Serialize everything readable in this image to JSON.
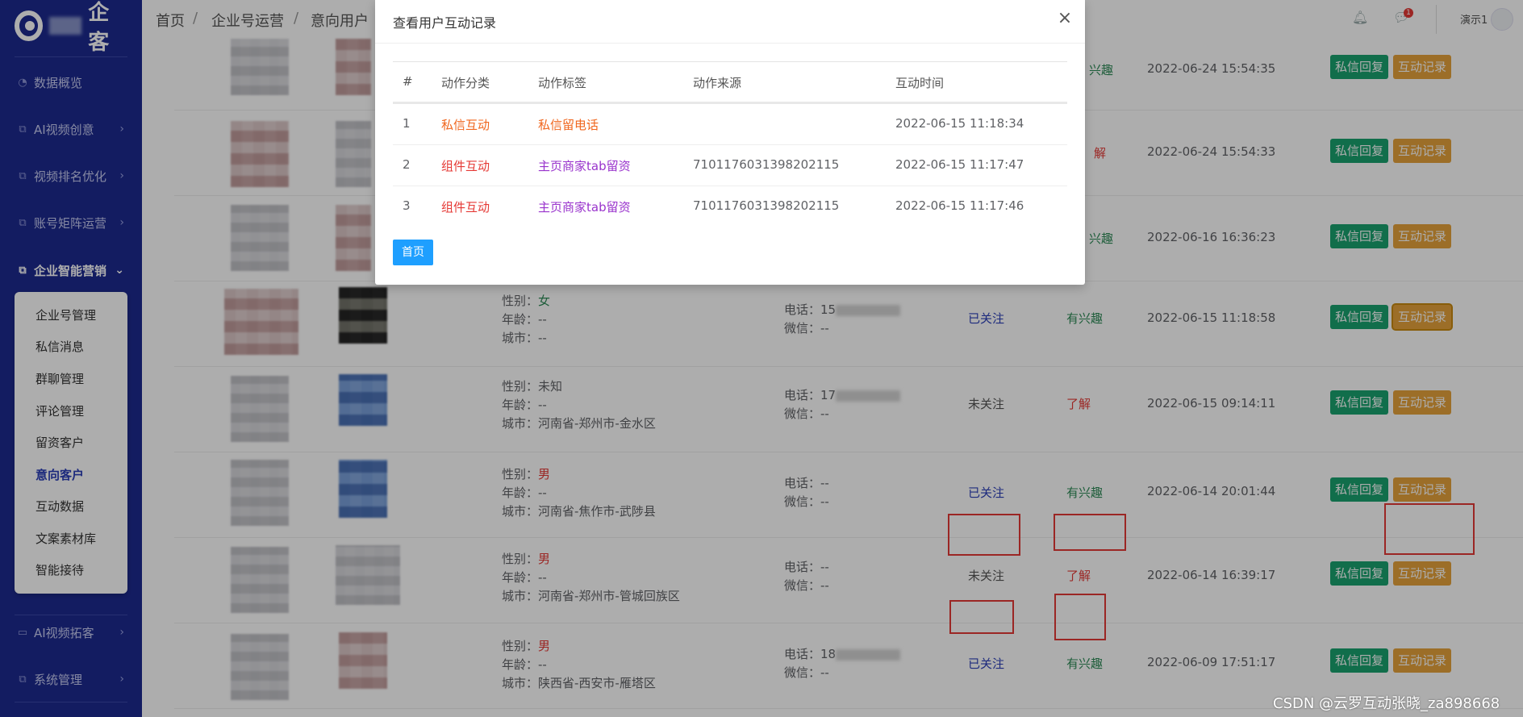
{
  "brand": {
    "text": "企客"
  },
  "sidebar": {
    "items": [
      {
        "label": "数据概览",
        "icon": "dashboard-icon"
      },
      {
        "label": "AI视频创意",
        "icon": "layers-icon"
      },
      {
        "label": "视频排名优化",
        "icon": "layers-icon"
      },
      {
        "label": "账号矩阵运营",
        "icon": "layers-icon"
      },
      {
        "label": "企业智能营销",
        "icon": "layers-icon"
      },
      {
        "label": "AI视频拓客",
        "icon": "card-icon"
      },
      {
        "label": "系统管理",
        "icon": "layers-icon"
      }
    ],
    "submenu": [
      "企业号管理",
      "私信消息",
      "群聊管理",
      "评论管理",
      "留资客户",
      "意向客户",
      "互动数据",
      "文案素材库",
      "智能接待"
    ]
  },
  "header": {
    "breadcrumb": [
      "首页",
      "企业号运营",
      "意向用户"
    ],
    "separator": "/",
    "notification_count": "1",
    "user": "演示1"
  },
  "rows": [
    {
      "gender_label": "性别：",
      "gender": "女",
      "age": "年龄：--",
      "city": "城市：--",
      "phone_label": "电话：",
      "phone": "15",
      "wechat": "微信：--",
      "follow": "已关注",
      "intent": "有兴趣",
      "time": "2022-06-15 11:18:58"
    },
    {
      "gender_label": "性别：",
      "gender": "未知",
      "age": "年龄：--",
      "city": "城市：河南省-郑州市-金水区",
      "phone_label": "电话：",
      "phone": "17",
      "wechat": "微信：--",
      "follow": "未关注",
      "intent": "了解",
      "time": "2022-06-15 09:14:11"
    },
    {
      "gender_label": "性别：",
      "gender": "男",
      "age": "年龄：--",
      "city": "城市：河南省-焦作市-武陟县",
      "phone_label": "电话：",
      "phone": "--",
      "wechat": "微信：--",
      "follow": "已关注",
      "intent": "有兴趣",
      "time": "2022-06-14 20:01:44"
    },
    {
      "gender_label": "性别：",
      "gender": "男",
      "age": "年龄：--",
      "city": "城市：河南省-郑州市-管城回族区",
      "phone_label": "电话：",
      "phone": "--",
      "wechat": "微信：--",
      "follow": "未关注",
      "intent": "了解",
      "time": "2022-06-14 16:39:17"
    },
    {
      "gender_label": "性别：",
      "gender": "男",
      "age": "年龄：--",
      "city": "城市：陕西省-西安市-雁塔区",
      "phone_label": "电话：",
      "phone": "18",
      "wechat": "微信：--",
      "follow": "已关注",
      "intent": "有兴趣",
      "time": "2022-06-09 17:51:17"
    }
  ],
  "upper_rows": [
    {
      "intent": "兴趣",
      "time": "2022-06-24 15:54:35"
    },
    {
      "intent": "解",
      "time": "2022-06-24 15:54:33"
    },
    {
      "intent": "兴趣",
      "time": "2022-06-16 16:36:23"
    }
  ],
  "row_actions": {
    "reply": "私信回复",
    "record": "互动记录"
  },
  "modal": {
    "title": "查看用户互动记录",
    "close": "×",
    "columns": [
      "#",
      "动作分类",
      "动作标签",
      "动作来源",
      "互动时间"
    ],
    "records": [
      {
        "idx": "1",
        "category": "私信互动",
        "tag": "私信留电话",
        "source": "",
        "time": "2022-06-15 11:18:34"
      },
      {
        "idx": "2",
        "category": "组件互动",
        "tag": "主页商家tab留资",
        "source": "7101176031398202115",
        "time": "2022-06-15 11:17:47"
      },
      {
        "idx": "3",
        "category": "组件互动",
        "tag": "主页商家tab留资",
        "source": "7101176031398202115",
        "time": "2022-06-15 11:17:46"
      }
    ],
    "page_button": "首页"
  },
  "watermark": "CSDN @云罗互动张晓_za898668",
  "colors": {
    "sidebar": "#1d2a8f",
    "green_button": "#1aa36f",
    "yellow_button": "#e6a23c",
    "primary": "#1e9fff",
    "red": "#e53935"
  }
}
